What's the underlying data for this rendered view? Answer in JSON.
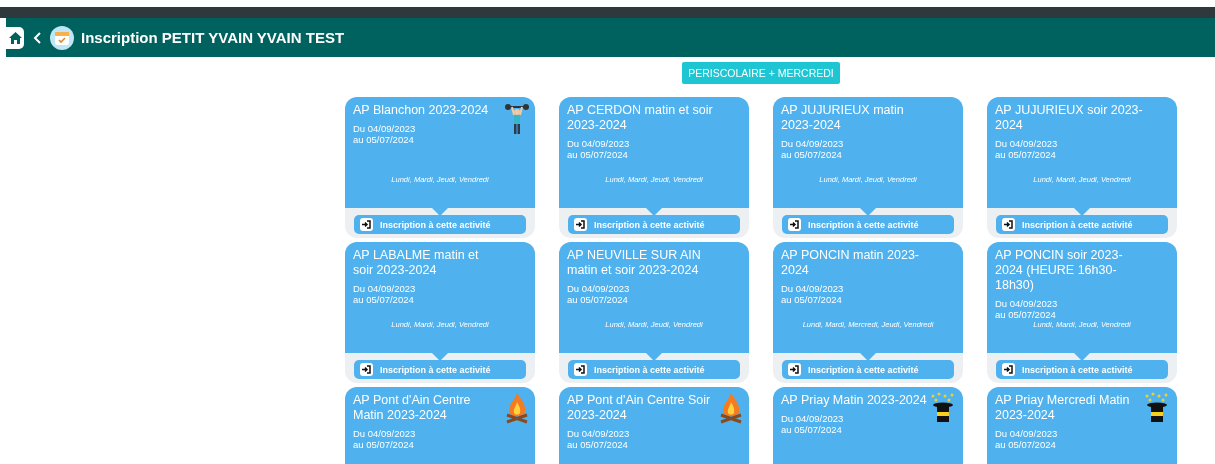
{
  "header": {
    "title": "Inscription PETIT YVAIN YVAIN TEST"
  },
  "category_button": "PERISCOLAIRE + MERCREDI",
  "activities": [
    {
      "title": "AP Blanchon 2023-2024",
      "kind": "weightlifter",
      "start": "Du 04/09/2023",
      "end": "au 05/07/2024",
      "days": "Lundi, Mardi, Jeudi, Vendredi",
      "action": "Inscription à cette activité"
    },
    {
      "title": "AP CERDON matin et soir 2023-2024",
      "start": "Du 04/09/2023",
      "end": "au 05/07/2024",
      "days": "Lundi, Mardi, Jeudi, Vendredi",
      "action": "Inscription à cette activité"
    },
    {
      "title": "AP JUJURIEUX matin 2023-2024",
      "start": "Du 04/09/2023",
      "end": "au 05/07/2024",
      "days": "Lundi, Mardi, Jeudi, Vendredi",
      "action": "Inscription à cette activité"
    },
    {
      "title": "AP JUJURIEUX soir 2023-2024",
      "start": "Du 04/09/2023",
      "end": "au 05/07/2024",
      "days": "Lundi, Mardi, Jeudi, Vendredi",
      "action": "Inscription à cette activité"
    },
    {
      "title": "AP LABALME matin et soir 2023-2024",
      "start": "Du 04/09/2023",
      "end": "au 05/07/2024",
      "days": "Lundi, Mardi, Jeudi, Vendredi",
      "action": "Inscription à cette activité"
    },
    {
      "title": "AP NEUVILLE SUR AIN matin et soir 2023-2024",
      "start": "Du 04/09/2023",
      "end": "au 05/07/2024",
      "days": "Lundi, Mardi, Jeudi, Vendredi",
      "action": "Inscription à cette activité"
    },
    {
      "title": "AP PONCIN matin 2023-2024",
      "start": "Du 04/09/2023",
      "end": "au 05/07/2024",
      "days": "Lundi, Mardi, Mercredi, Jeudi, Vendredi",
      "action": "Inscription à cette activité"
    },
    {
      "title": "AP PONCIN soir 2023-2024 (HEURE 16h30-18h30)",
      "start": "Du 04/09/2023",
      "end": "au 05/07/2024",
      "days": "Lundi, Mardi, Jeudi, Vendredi",
      "action": "Inscription à cette activité"
    },
    {
      "title": "AP Pont d'Ain Centre Matin 2023-2024",
      "kind": "campfire",
      "start": "Du 04/09/2023",
      "end": "au 05/07/2024"
    },
    {
      "title": "AP Pont d'Ain Centre Soir 2023-2024",
      "kind": "campfire",
      "start": "Du 04/09/2023",
      "end": "au 05/07/2024"
    },
    {
      "title": "AP Priay Matin 2023-2024",
      "kind": "magic-hat",
      "start": "Du 04/09/2023",
      "end": "au 05/07/2024"
    },
    {
      "title": "AP Priay Mercredi Matin 2023-2024",
      "kind": "magic-hat",
      "start": "Du 04/09/2023",
      "end": "au 05/07/2024"
    }
  ]
}
